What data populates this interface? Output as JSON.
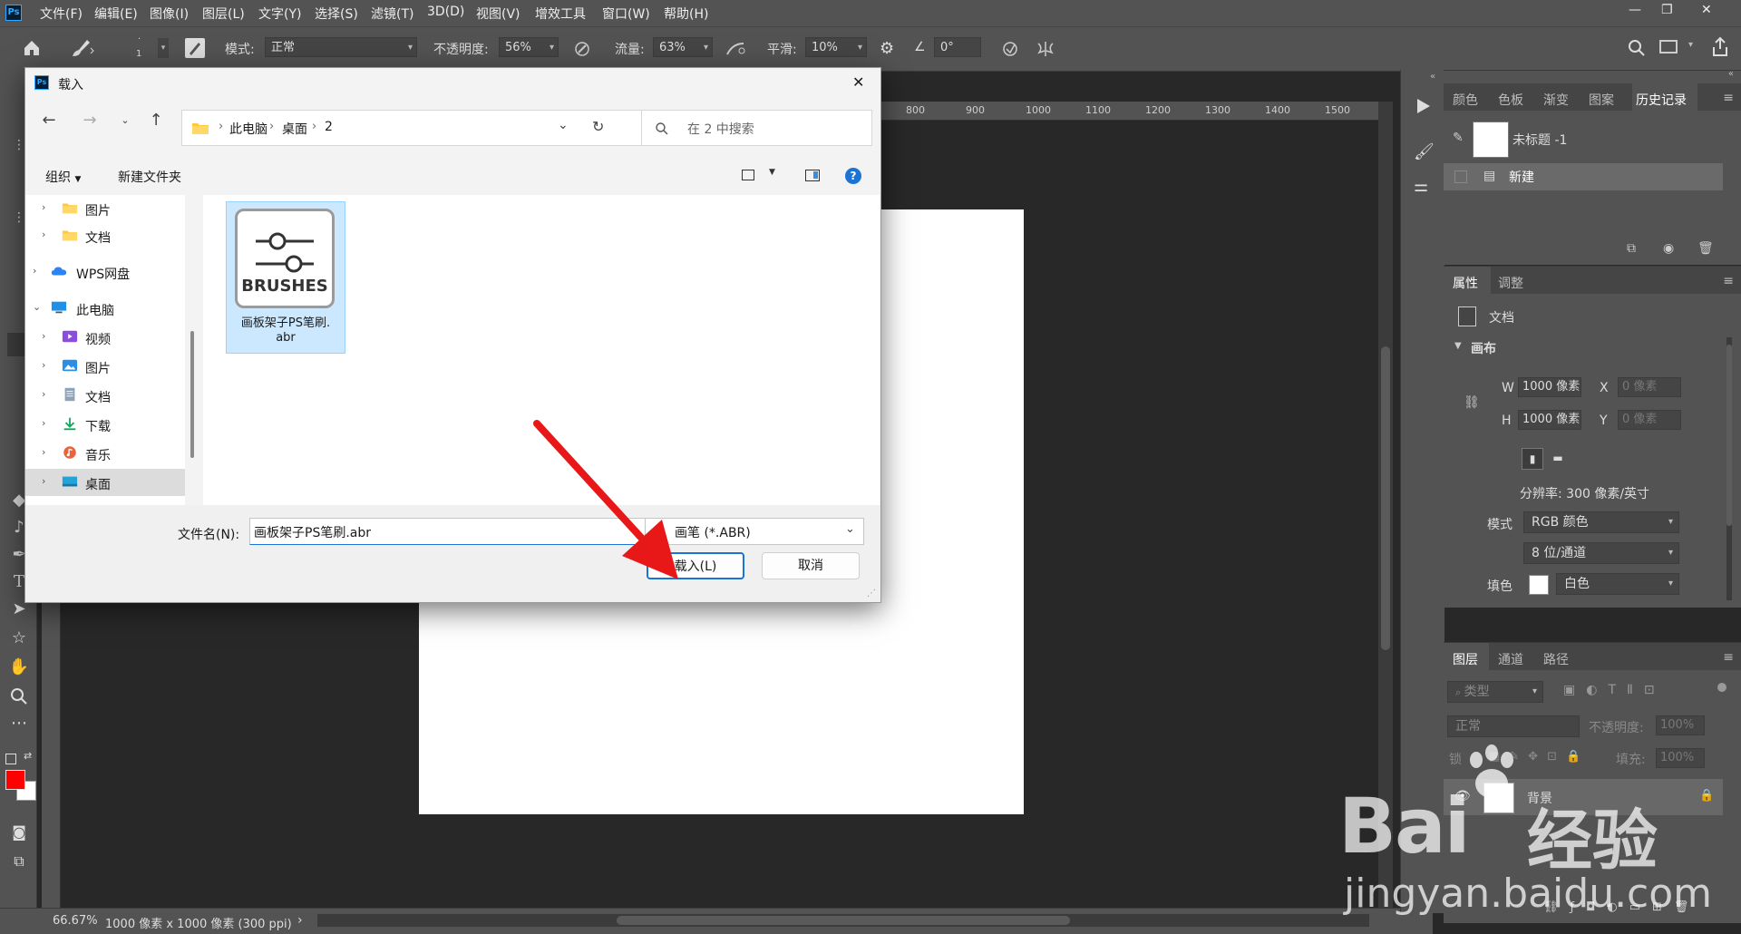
{
  "app": {
    "menu": [
      "文件(F)",
      "编辑(E)",
      "图像(I)",
      "图层(L)",
      "文字(Y)",
      "选择(S)",
      "滤镜(T)",
      "3D(D)",
      "视图(V)",
      "增效工具",
      "窗口(W)",
      "帮助(H)"
    ],
    "window_controls": [
      "—",
      "❐",
      "✕"
    ]
  },
  "options": {
    "brush_size": "1",
    "mode_label": "模式:",
    "mode_value": "正常",
    "opacity_label": "不透明度:",
    "opacity_value": "56%",
    "flow_label": "流量:",
    "flow_value": "63%",
    "smooth_label": "平滑:",
    "smooth_value": "10%",
    "angle_value": "0°"
  },
  "ruler": {
    "ticks": [
      "800",
      "900",
      "1000",
      "1100",
      "1200",
      "1300",
      "1400",
      "1500"
    ]
  },
  "status": {
    "zoom": "66.67%",
    "doc_info": "1000 像素 x 1000 像素 (300 ppi)",
    "arrow": "›"
  },
  "history_panel": {
    "tabs": [
      "颜色",
      "色板",
      "渐变",
      "图案",
      "历史记录"
    ],
    "snapshot_name": "未标题 -1",
    "step_name": "新建"
  },
  "properties_panel": {
    "tabs": [
      "属性",
      "调整"
    ],
    "doc_label": "文档",
    "canvas_section": "画布",
    "w_label": "W",
    "w_value": "1000 像素",
    "h_label": "H",
    "h_value": "1000 像素",
    "x_label": "X",
    "x_value": "0 像素",
    "y_label": "Y",
    "y_value": "0 像素",
    "resolution": "分辨率: 300 像素/英寸",
    "mode_label": "模式",
    "mode_value": "RGB 颜色",
    "depth_value": "8 位/通道",
    "fill_label": "填色",
    "fill_value": "白色"
  },
  "layers_panel": {
    "tabs": [
      "图层",
      "通道",
      "路径"
    ],
    "filter_type": "类型",
    "blend_mode": "正常",
    "opacity_label": "不透明度:",
    "opacity_value": "100%",
    "lock_label": "锁",
    "fill_label": "填充:",
    "fill_value": "100%",
    "layer_name": "背景"
  },
  "dialog": {
    "title": "载入",
    "close": "✕",
    "breadcrumb": [
      "此电脑",
      "桌面",
      "2"
    ],
    "search_placeholder": "在 2 中搜索",
    "organize": "组织",
    "new_folder": "新建文件夹",
    "help": "?",
    "nav": [
      {
        "label": "图片",
        "icon": "folder-icon"
      },
      {
        "label": "文档",
        "icon": "folder-icon"
      },
      {
        "label": "WPS网盘",
        "icon": "cloud-icon"
      },
      {
        "label": "此电脑",
        "icon": "computer-icon"
      },
      {
        "label": "视频",
        "icon": "video-icon"
      },
      {
        "label": "图片",
        "icon": "pictures-icon"
      },
      {
        "label": "文档",
        "icon": "documents-icon"
      },
      {
        "label": "下载",
        "icon": "download-icon"
      },
      {
        "label": "音乐",
        "icon": "music-icon"
      },
      {
        "label": "桌面",
        "icon": "desktop-icon"
      }
    ],
    "file": {
      "icon_text": "BRUSHES",
      "name_line1": "画板架子PS笔刷.",
      "name_line2": "abr"
    },
    "filename_label": "文件名(N):",
    "filename_value": "画板架子PS笔刷.abr",
    "filetype_value": "画笔 (*.ABR)",
    "load_button": "载入(L)",
    "cancel_button": "取消"
  },
  "watermark": {
    "brand": "Bai",
    "brand2": "经验",
    "url": "jingyan.baidu.com"
  },
  "colors": {
    "foreground": "#ff0000",
    "background": "#ffffff",
    "arrow": "#e81818"
  }
}
